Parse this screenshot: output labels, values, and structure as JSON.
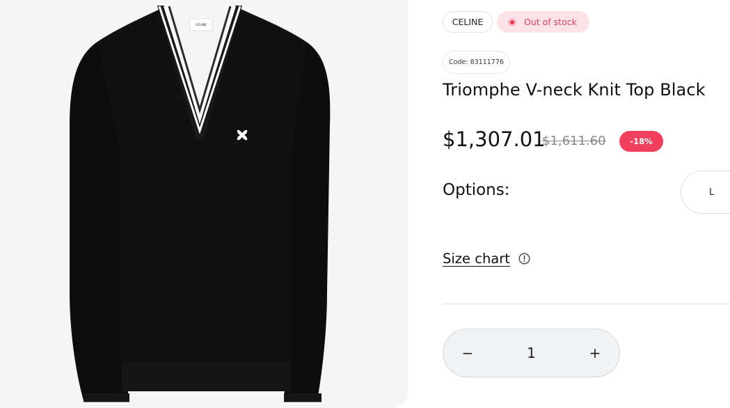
{
  "product": {
    "brand": "CELINE",
    "stock_status": "Out of stock",
    "code": "Code: 83111776",
    "title": "Triomphe V-neck Knit Top Black",
    "price": "$1,307.01",
    "old_price": "$1,611.60",
    "discount": "-18%",
    "label_tag_text": "CELINE"
  },
  "options": {
    "label": "Options:",
    "sizes": [
      "L"
    ]
  },
  "size_chart": {
    "label": "Size chart"
  },
  "quantity": {
    "minus": "−",
    "value": "1",
    "plus": "+"
  },
  "colors": {
    "accent": "#f23f5d",
    "stock_bg": "#fde3e8",
    "stock_text": "#e2405f",
    "image_bg": "#f5f5f5",
    "sweater": "#0d0d0d"
  }
}
